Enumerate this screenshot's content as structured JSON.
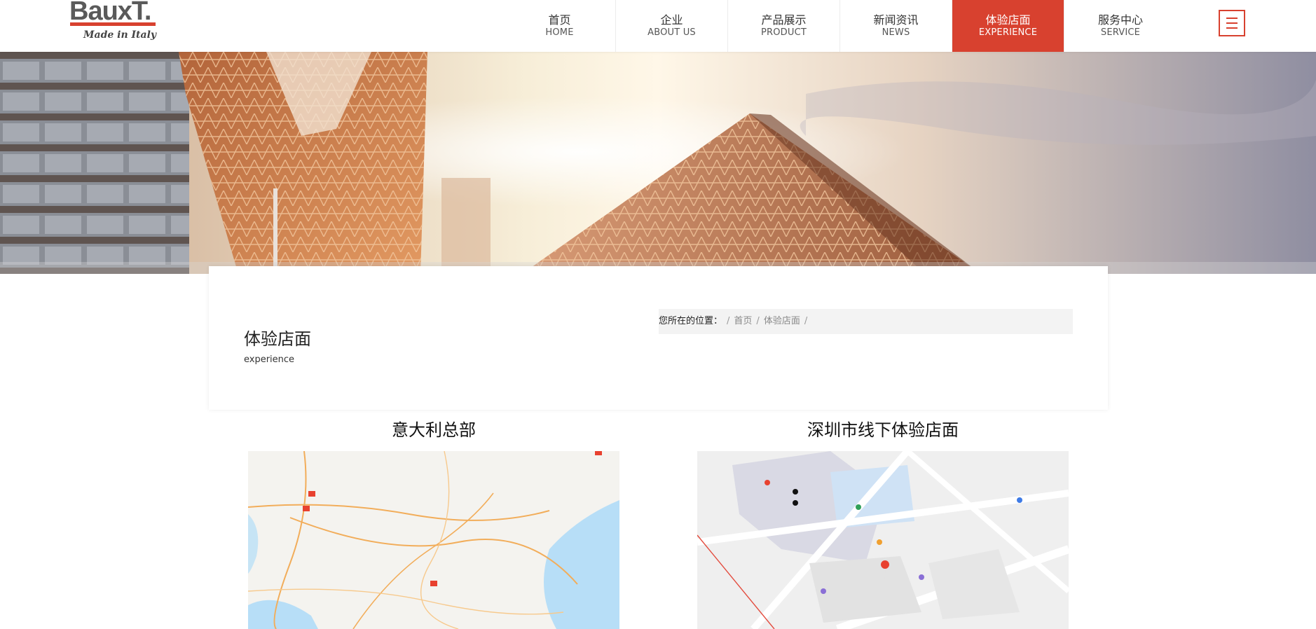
{
  "brand": {
    "name": "BauxT.",
    "tagline": "Made in Italy",
    "accent_color": "#d8412f"
  },
  "nav": {
    "items": [
      {
        "zh": "首页",
        "en": "HOME",
        "active": false
      },
      {
        "zh": "企业",
        "en": "ABOUT US",
        "active": false
      },
      {
        "zh": "产品展示",
        "en": "PRODUCT",
        "active": false
      },
      {
        "zh": "新闻资讯",
        "en": "NEWS",
        "active": false
      },
      {
        "zh": "体验店面",
        "en": "EXPERIENCE",
        "active": true
      },
      {
        "zh": "服务中心",
        "en": "SERVICE",
        "active": false
      }
    ],
    "menu_icon": "hamburger-menu-icon"
  },
  "page": {
    "title": "体验店面",
    "subtitle": "experience"
  },
  "breadcrumb": {
    "label": "您所在的位置：",
    "separator": "/",
    "items": [
      "首页",
      "体验店面"
    ]
  },
  "locations": [
    {
      "title": "意大利总部"
    },
    {
      "title": "深圳市线下体验店面"
    }
  ]
}
